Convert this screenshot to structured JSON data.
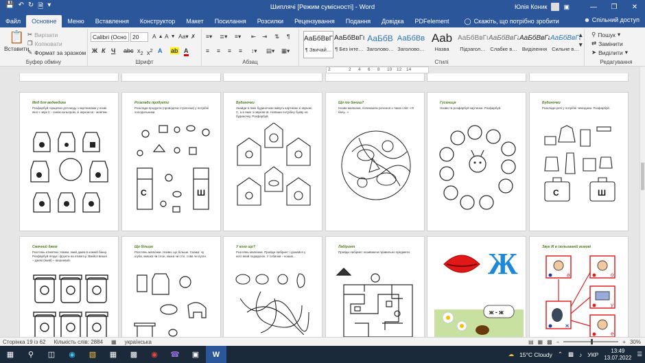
{
  "titlebar": {
    "title": "Шиплячі [Режим сумісності] - Word",
    "user": "Юлія Коник"
  },
  "tabs": [
    "Файл",
    "Основне",
    "Меню",
    "Вставлення",
    "Конструктор",
    "Макет",
    "Посилання",
    "Розсилки",
    "Рецензування",
    "Подання",
    "Довідка",
    "PDFelement"
  ],
  "tellme": "Скажіть, що потрібно зробити",
  "share": "Спільний доступ",
  "ribbon": {
    "clipboard": {
      "paste": "Вставити",
      "cut": "Вирізати",
      "copy": "Копіювати",
      "painter": "Формат за зразком",
      "label": "Буфер обміну"
    },
    "font": {
      "name": "Calibri (Осно",
      "size": "20",
      "label": "Шрифт"
    },
    "paragraph": {
      "label": "Абзац"
    },
    "styles": {
      "label": "Стилі",
      "items": [
        {
          "sample": "АаБбВвГг",
          "name": "¶ Звичай…"
        },
        {
          "sample": "АаБбВвГг",
          "name": "¶ Без інте…"
        },
        {
          "sample": "АаБбВ",
          "name": "Заголово…"
        },
        {
          "sample": "АаБбВв",
          "name": "Заголово…"
        },
        {
          "sample": "Aab",
          "name": "Назва"
        },
        {
          "sample": "АаБбВвГг",
          "name": "Підзагол…"
        },
        {
          "sample": "АаБбВвГг",
          "name": "Слабке в…"
        },
        {
          "sample": "АаБбВвГг",
          "name": "Виділення"
        },
        {
          "sample": "АаБбВвГг",
          "name": "Сильне в…"
        }
      ]
    },
    "editing": {
      "find": "Пошук",
      "replace": "Замінити",
      "select": "Виділити",
      "label": "Редагування"
    }
  },
  "ruler": [
    "2",
    "2",
    "4",
    "6",
    "8",
    "10",
    "12",
    "14"
  ],
  "pages": [
    {
      "title": "Мед для ведмедика",
      "text": "Розфарбуй горщечки для меду з картинками у назві якої є звук С - синім кольором, зі звуком Ш - жовтим."
    },
    {
      "title": "Розклади продукти",
      "text": "Розклади продукти (проводячи стрілочки) у потрібні холодильники."
    },
    {
      "title": "Будиночки",
      "text": "Знайди в яких будиночках живуть картинки зі звуком С, а в яких зі звуком Ш. Напиши потрібну букву на будиночку. Розфарбуй."
    },
    {
      "title": "Що то бачиш?",
      "text": "Назви малюнки, починаючи речення з таких слів: «Я бачу...»"
    },
    {
      "title": "Гусениця",
      "text": "Назви та розфарбуй картинки. Розфарбуй."
    },
    {
      "title": "Будиночки",
      "text": "Розклади речі у потрібні чемодани. Розфарбуй."
    },
    {
      "title": "Смачний джем",
      "text": "Розглянь етикетки. Назви, який джем в кожній банці. Розфарбуй ягоди і фрукти на етикетці. Вмійся вишні – джем (який) – вишневий."
    },
    {
      "title": "Що більше",
      "text": "Розглянь малюнки. Назви, що більше. Скажи: чу шуба, мишка чи слон, кішка чи стіл, сова чи пугач."
    },
    {
      "title": "У кого що?",
      "text": "Розглянь малюнки. Пройди лабіринт і дізнайся у кого який подарунок. У собачки – кошик..."
    },
    {
      "title": "Лабіринт",
      "text": "Пройди лабіринт називаючи правильно предмети."
    },
    {
      "title": "",
      "text": "",
      "letter": "Ж",
      "bubble": "ж - ж"
    },
    {
      "title": "Звук Ж в ізольованій вимові",
      "text": "",
      "labels": [
        "а",
        "о",
        "у",
        "е",
        "ж"
      ]
    }
  ],
  "status": {
    "page": "Сторінка 19 із 62",
    "words": "Кількість слів: 2884",
    "lang": "українська",
    "zoom": "30%"
  },
  "taskbar": {
    "weather": "15°C  Cloudy",
    "lang": "УКР",
    "time": "13:49",
    "date": "13.07.2022"
  },
  "colors": {
    "accent": "#2b579a",
    "titlegreen": "#4a7a18",
    "letterblue": "#1e88d8"
  }
}
